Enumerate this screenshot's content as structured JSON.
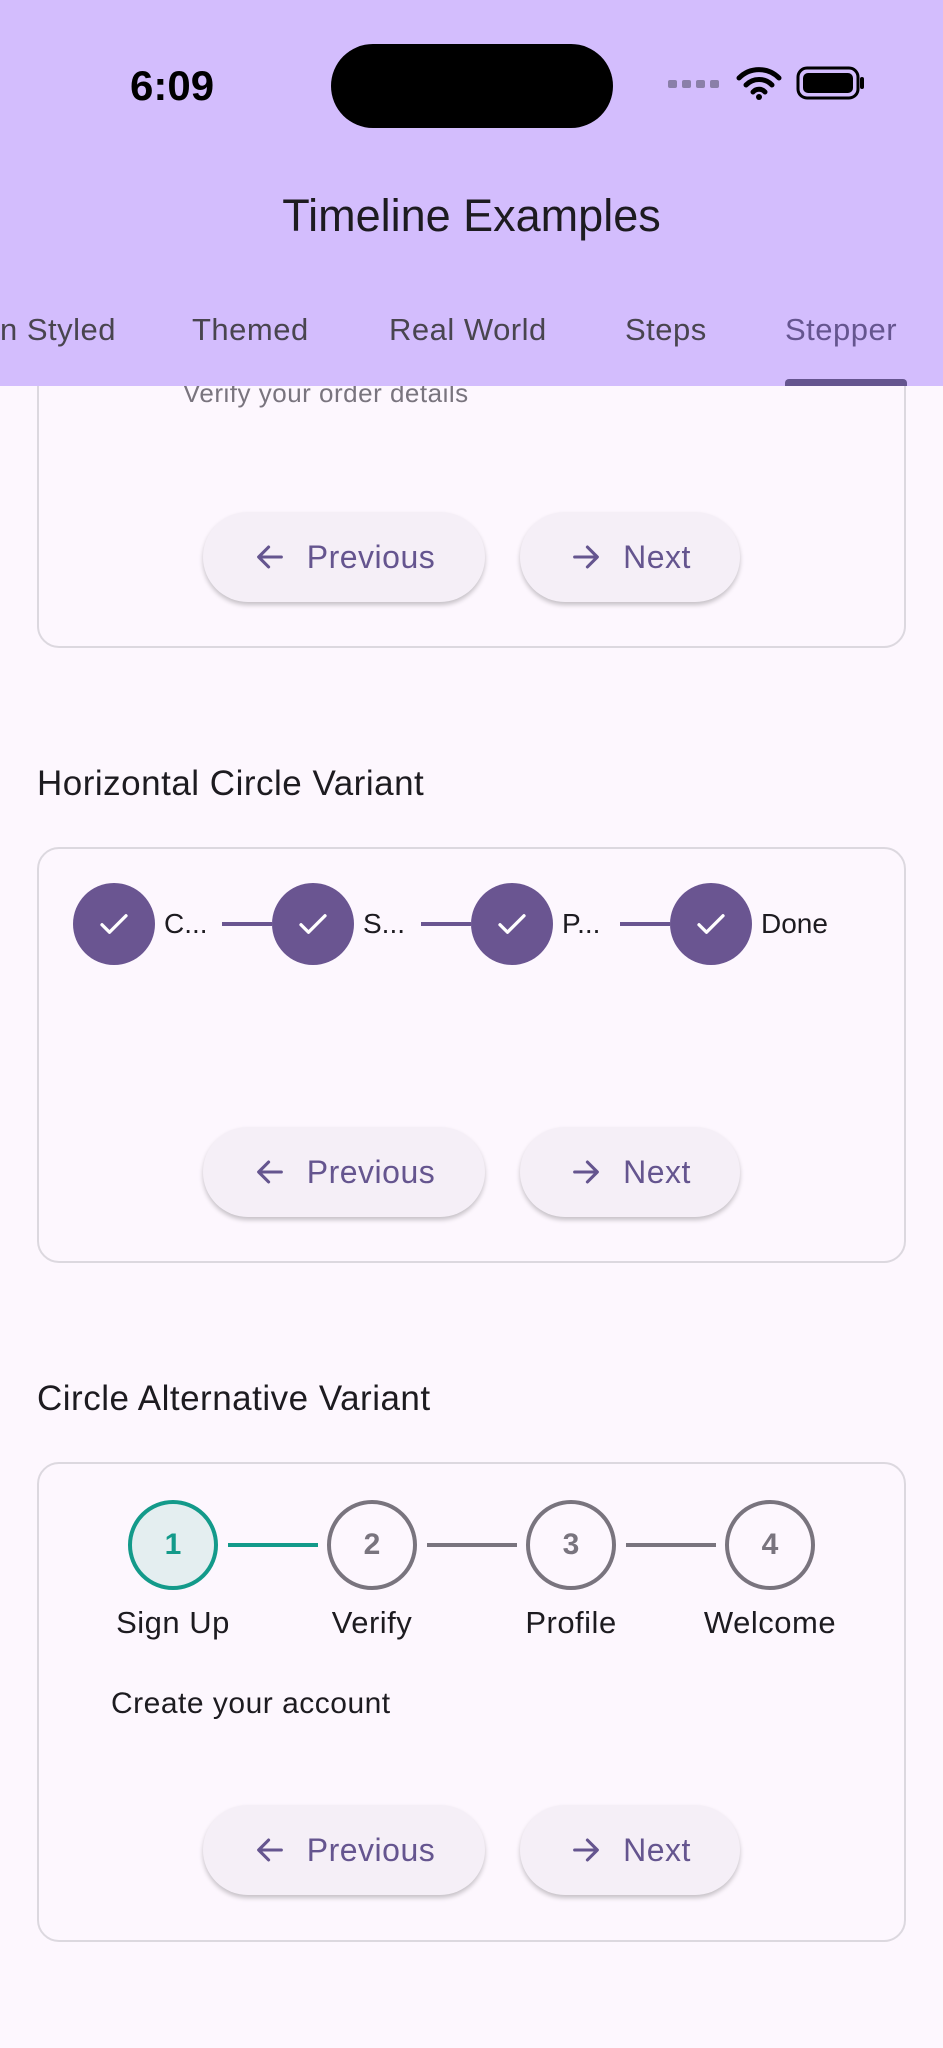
{
  "status_bar": {
    "time": "6:09"
  },
  "app_bar": {
    "title": "Timeline Examples"
  },
  "tabs": [
    {
      "label": "n Styled"
    },
    {
      "label": "Themed"
    },
    {
      "label": "Real World"
    },
    {
      "label": "Steps"
    },
    {
      "label": "Stepper"
    }
  ],
  "top_card": {
    "subtitle": "Verify your order details"
  },
  "buttons": {
    "previous": "Previous",
    "next": "Next"
  },
  "horizontal_circle": {
    "title": "Horizontal Circle Variant",
    "steps": [
      {
        "label": "C..."
      },
      {
        "label": "S..."
      },
      {
        "label": "P..."
      },
      {
        "label": "Done"
      }
    ]
  },
  "circle_alternative": {
    "title": "Circle Alternative Variant",
    "steps": [
      {
        "number": "1",
        "label": "Sign Up"
      },
      {
        "number": "2",
        "label": "Verify"
      },
      {
        "number": "3",
        "label": "Profile"
      },
      {
        "number": "4",
        "label": "Welcome"
      }
    ],
    "description": "Create your account"
  },
  "colors": {
    "primary": "#65558f",
    "app_bar": "#d3bdfd",
    "step_done": "#6a5591",
    "step_active": "#139a8a",
    "inactive": "#79747e"
  },
  "icons": {
    "done_step": "check-icon",
    "previous": "arrow-left-icon",
    "next": "arrow-right-icon"
  }
}
